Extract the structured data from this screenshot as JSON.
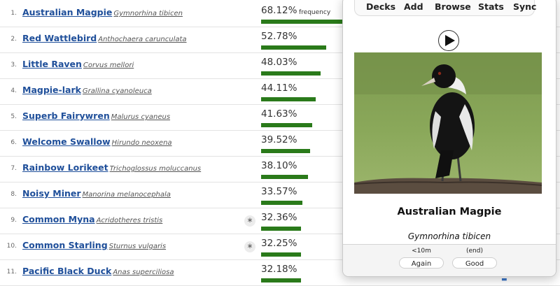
{
  "list": {
    "pct_label": "frequency",
    "rows": [
      {
        "rank": "1.",
        "common": "Australian Magpie",
        "sci": "Gymnorhina tibicen",
        "pct": "68.12%",
        "freq": 68.12,
        "star": false
      },
      {
        "rank": "2.",
        "common": "Red Wattlebird",
        "sci": "Anthochaera carunculata",
        "pct": "52.78%",
        "freq": 52.78,
        "star": false
      },
      {
        "rank": "3.",
        "common": "Little Raven",
        "sci": "Corvus mellori",
        "pct": "48.03%",
        "freq": 48.03,
        "star": false
      },
      {
        "rank": "4.",
        "common": "Magpie-lark",
        "sci": "Grallina cyanoleuca",
        "pct": "44.11%",
        "freq": 44.11,
        "star": false
      },
      {
        "rank": "5.",
        "common": "Superb Fairywren",
        "sci": "Malurus cyaneus",
        "pct": "41.63%",
        "freq": 41.63,
        "star": false
      },
      {
        "rank": "6.",
        "common": "Welcome Swallow",
        "sci": "Hirundo neoxena",
        "pct": "39.52%",
        "freq": 39.52,
        "star": false
      },
      {
        "rank": "7.",
        "common": "Rainbow Lorikeet",
        "sci": "Trichoglossus moluccanus",
        "pct": "38.10%",
        "freq": 38.1,
        "star": false
      },
      {
        "rank": "8.",
        "common": "Noisy Miner",
        "sci": "Manorina melanocephala",
        "pct": "33.57%",
        "freq": 33.57,
        "star": false
      },
      {
        "rank": "9.",
        "common": "Common Myna",
        "sci": "Acridotheres tristis",
        "pct": "32.36%",
        "freq": 32.36,
        "star": true
      },
      {
        "rank": "10.",
        "common": "Common Starling",
        "sci": "Sturnus vulgaris",
        "pct": "32.25%",
        "freq": 32.25,
        "star": true
      },
      {
        "rank": "11.",
        "common": "Pacific Black Duck",
        "sci": "Anas superciliosa",
        "pct": "32.18%",
        "freq": 32.18,
        "star": false
      }
    ],
    "star_glyph": "*"
  },
  "review": {
    "toolbar": [
      "Decks",
      "Add",
      "Browse",
      "Stats",
      "Sync"
    ],
    "card_title": "Australian Magpie",
    "card_sci": "Gymnorhina tibicen",
    "answers": [
      {
        "interval": "<10m",
        "label": "Again"
      },
      {
        "interval": "(end)",
        "label": "Good"
      }
    ]
  },
  "colors": {
    "link": "#1f4f9a",
    "bar": "#2a7a1a"
  }
}
